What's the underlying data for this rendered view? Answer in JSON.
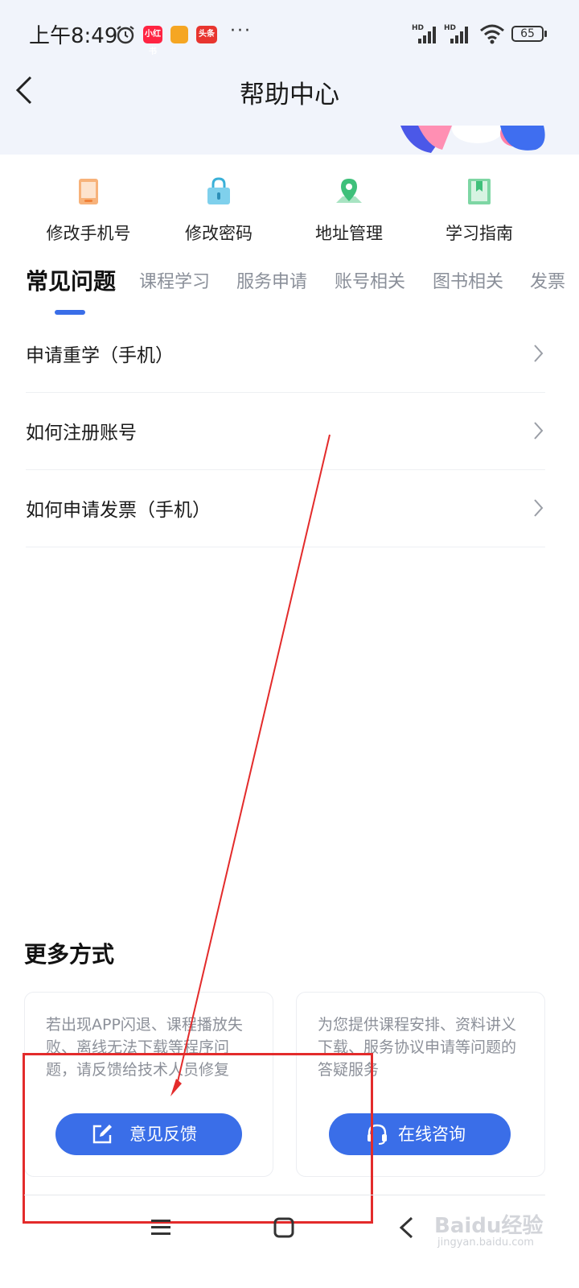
{
  "status_bar": {
    "time": "上午8:49",
    "badges": [
      "小红书",
      "",
      "头条"
    ],
    "more": "···",
    "signal_label": "HD",
    "battery": "65"
  },
  "header": {
    "title": "帮助中心",
    "background_color": "#f1f4fb"
  },
  "quick_links": [
    {
      "label": "修改手机号",
      "icon": "phone-icon",
      "color": "#f0823a"
    },
    {
      "label": "修改密码",
      "icon": "lock-icon",
      "color": "#3ab0d8"
    },
    {
      "label": "地址管理",
      "icon": "location-icon",
      "color": "#3ec07a"
    },
    {
      "label": "学习指南",
      "icon": "bookmark-icon",
      "color": "#3ec07a"
    }
  ],
  "tabs": [
    {
      "label": "常见问题",
      "active": true
    },
    {
      "label": "课程学习"
    },
    {
      "label": "服务申请"
    },
    {
      "label": "账号相关"
    },
    {
      "label": "图书相关"
    },
    {
      "label": "发票"
    }
  ],
  "faq": [
    {
      "title": "申请重学（手机）"
    },
    {
      "title": "如何注册账号"
    },
    {
      "title": "如何申请发票（手机）"
    }
  ],
  "more": {
    "title": "更多方式",
    "cards": [
      {
        "desc": "若出现APP闪退、课程播放失败、离线无法下载等程序问题，请反馈给技术人员修复",
        "button": "意见反馈",
        "icon": "edit-icon"
      },
      {
        "desc": "为您提供课程安排、资料讲义下载、服务协议申请等问题的答疑服务",
        "button": "在线咨询",
        "icon": "headset-icon"
      }
    ]
  },
  "watermark": {
    "main": "Baidu经验",
    "sub": "jingyan.baidu.com"
  },
  "colors": {
    "accent": "#3a6ee8",
    "annotation": "#e32b2b"
  }
}
